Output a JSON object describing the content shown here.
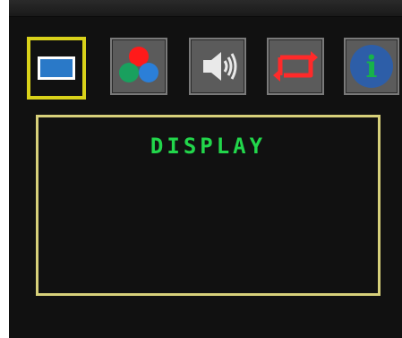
{
  "osd": {
    "menu_title": "DISPLAY",
    "tabs": [
      {
        "name": "display",
        "icon": "display-icon",
        "selected": true
      },
      {
        "name": "color",
        "icon": "color-balls-icon",
        "selected": false
      },
      {
        "name": "sound",
        "icon": "speaker-icon",
        "selected": false
      },
      {
        "name": "repeat",
        "icon": "repeat-icon",
        "selected": false
      },
      {
        "name": "information",
        "icon": "info-icon",
        "icon_text": "i",
        "selected": false
      }
    ],
    "colors": {
      "selection_frame": "#d9d21a",
      "panel_border": "#d7d07a",
      "title_text": "#22d64b",
      "background": "#111111"
    }
  }
}
